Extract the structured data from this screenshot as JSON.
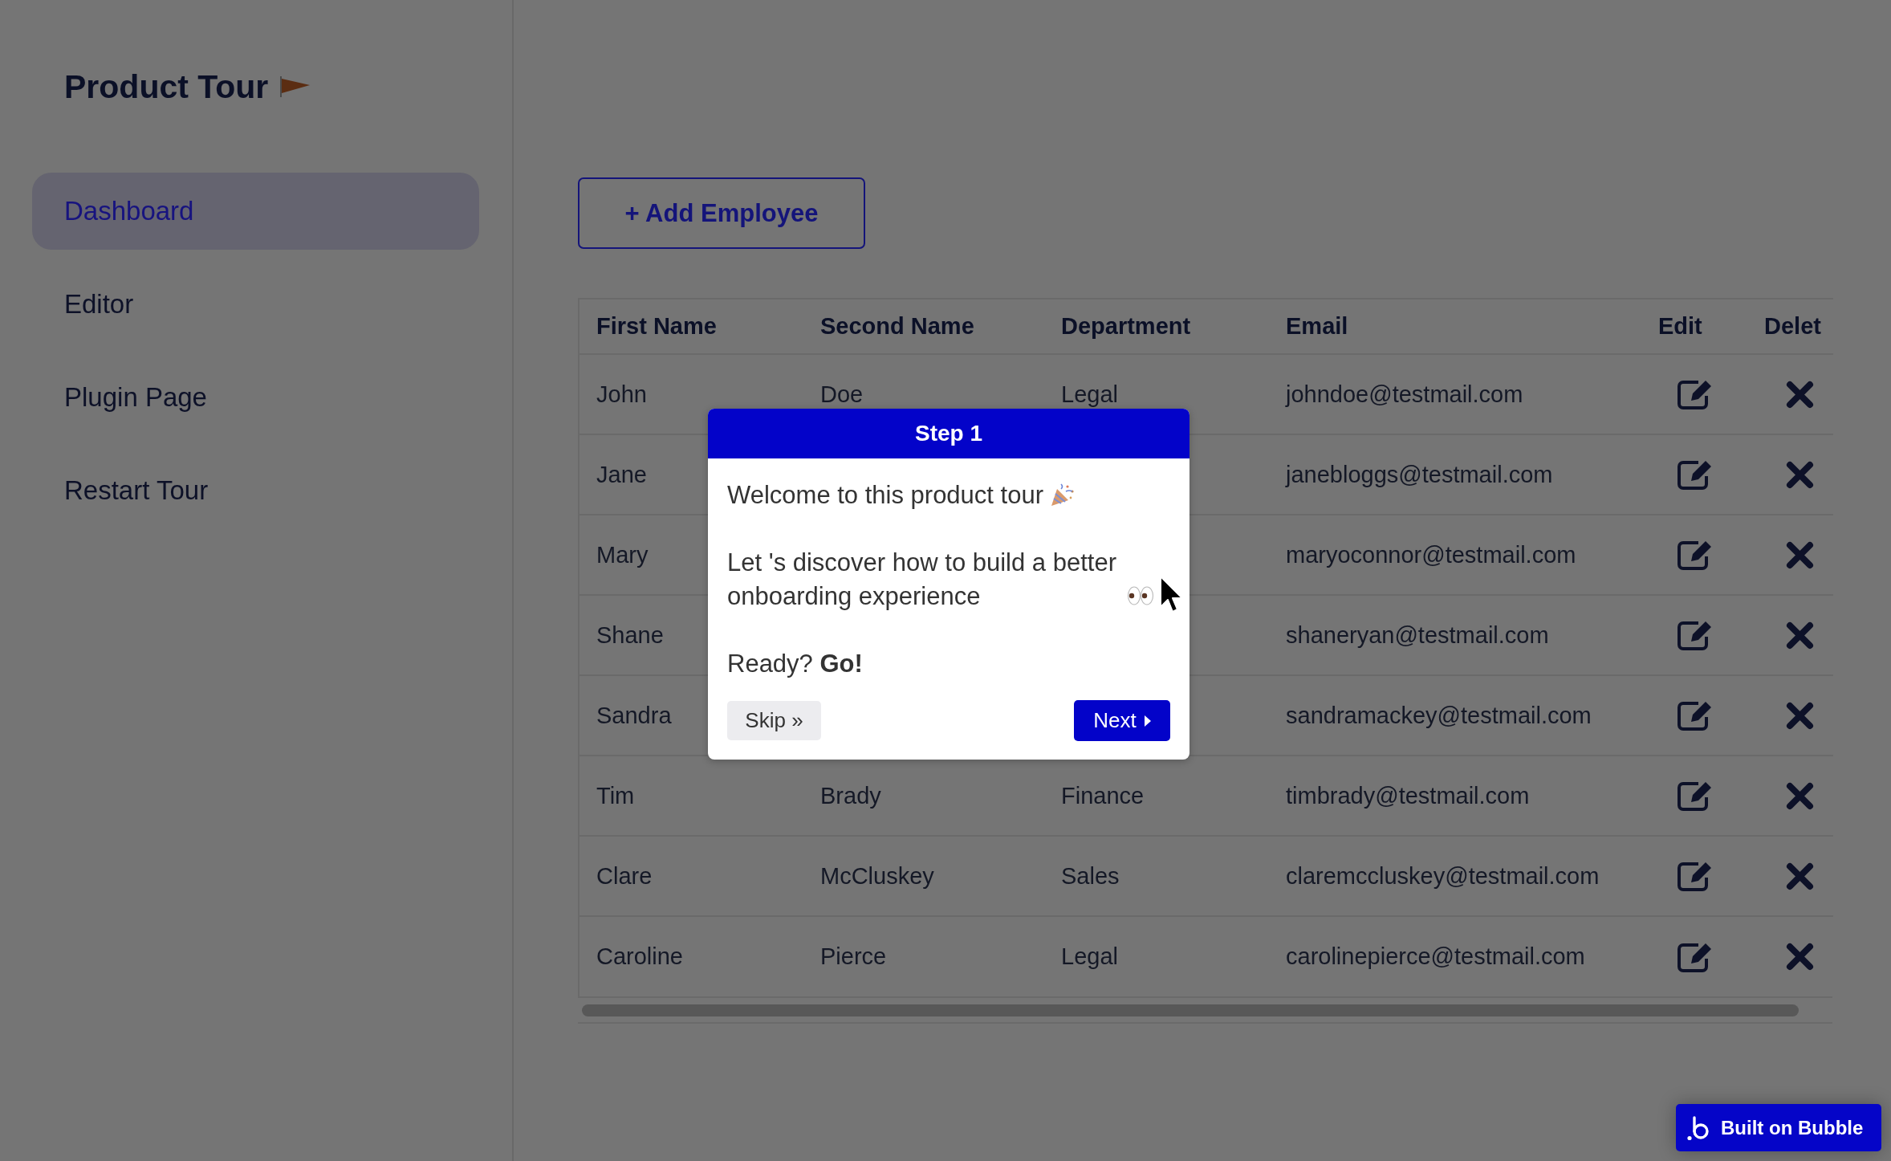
{
  "sidebar": {
    "title": "Product Tour",
    "items": [
      {
        "label": "Dashboard",
        "selected": true
      },
      {
        "label": "Editor",
        "selected": false
      },
      {
        "label": "Plugin Page",
        "selected": false
      },
      {
        "label": "Restart Tour",
        "selected": false
      }
    ]
  },
  "add_button": "+ Add Employee",
  "table": {
    "columns": [
      {
        "label": "First Name",
        "kind": "text"
      },
      {
        "label": "Second Name",
        "kind": "text"
      },
      {
        "label": "Department",
        "kind": "text"
      },
      {
        "label": "Email",
        "kind": "text"
      },
      {
        "label": "Edit",
        "kind": "edit"
      },
      {
        "label": "Delet",
        "kind": "delete"
      }
    ],
    "rows": [
      {
        "first_name": "John",
        "second_name": "Doe",
        "department": "Legal",
        "email": "johndoe@testmail.com"
      },
      {
        "first_name": "Jane",
        "email": "janebloggs@testmail.com"
      },
      {
        "first_name": "Mary",
        "email": "maryoconnor@testmail.com"
      },
      {
        "first_name": "Shane",
        "email": "shaneryan@testmail.com"
      },
      {
        "first_name": "Sandra",
        "email": "sandramackey@testmail.com"
      },
      {
        "first_name": "Tim",
        "second_name": "Brady",
        "department": "Finance",
        "email": "timbrady@testmail.com"
      },
      {
        "first_name": "Clare",
        "second_name": "McCluskey",
        "department": "Sales",
        "email": "claremccluskey@testmail.com"
      },
      {
        "first_name": "Caroline",
        "second_name": "Pierce",
        "department": "Legal",
        "email": "carolinepierce@testmail.com"
      }
    ]
  },
  "tour_popup": {
    "title": "Step 1",
    "welcome": "Welcome to this product tour",
    "intro": "Let 's discover how to build a better onboarding experience",
    "prompt": "Ready? **Go!**",
    "skip_button": "Skip »",
    "next_button": "Next"
  },
  "badge": "Built on Bubble"
}
